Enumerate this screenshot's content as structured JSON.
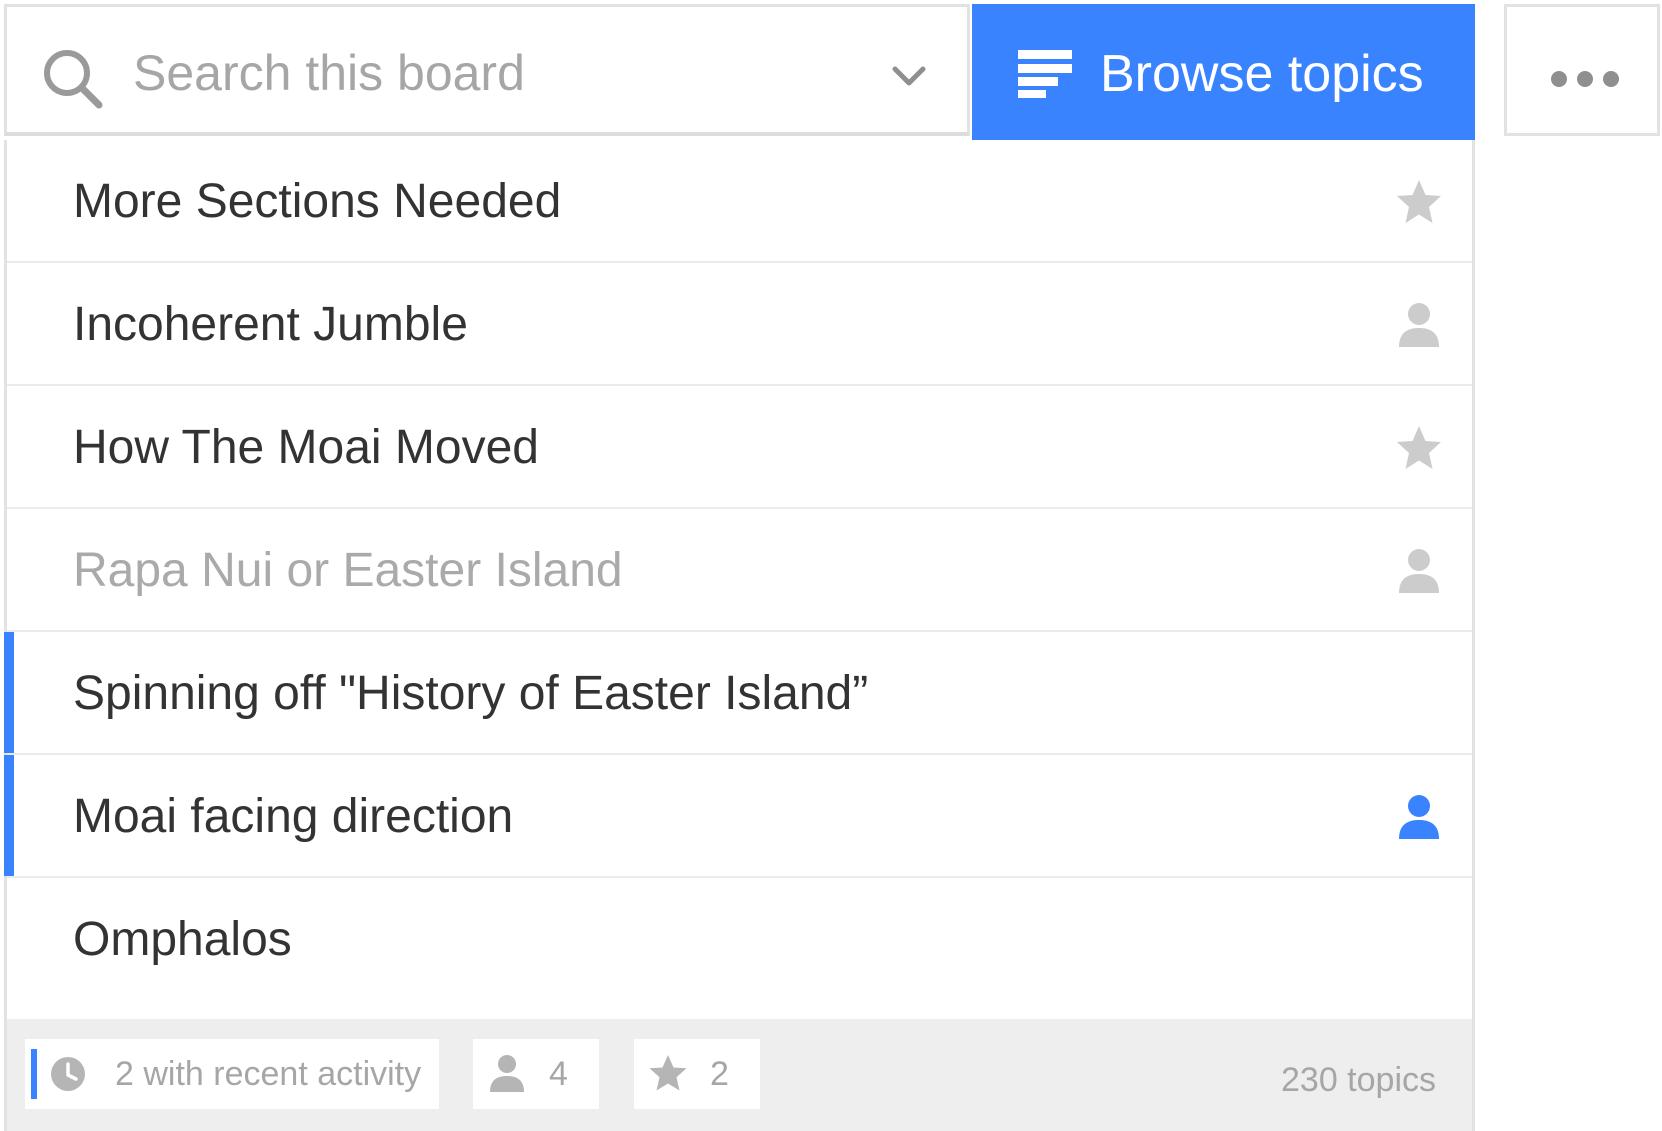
{
  "search": {
    "placeholder": "Search this board",
    "value": ""
  },
  "toolbar": {
    "browse_label": "Browse topics",
    "more_icon": "more-horizontal-icon"
  },
  "colors": {
    "accent": "#3a83ff",
    "icon_muted": "#cccccc",
    "text": "#333333",
    "text_muted": "#aaaaaa"
  },
  "topics": [
    {
      "title": "More Sections Needed",
      "icon": "star-icon",
      "muted": false,
      "highlighted": false
    },
    {
      "title": "Incoherent Jumble",
      "icon": "person-icon",
      "muted": false,
      "highlighted": false
    },
    {
      "title": "How The Moai Moved",
      "icon": "star-icon",
      "muted": false,
      "highlighted": false
    },
    {
      "title": "Rapa Nui or Easter Island",
      "icon": "person-icon",
      "muted": true,
      "highlighted": false
    },
    {
      "title": "Spinning off \"History of Easter Island”",
      "icon": "",
      "muted": false,
      "highlighted": true
    },
    {
      "title": "Moai facing direction",
      "icon": "person-icon-active",
      "muted": false,
      "highlighted": true
    },
    {
      "title": "Omphalos",
      "icon": "",
      "muted": false,
      "highlighted": false
    }
  ],
  "footer": {
    "recent_label": "2 with recent activity",
    "people_count": "4",
    "star_count": "2",
    "topic_count": "230 topics"
  }
}
